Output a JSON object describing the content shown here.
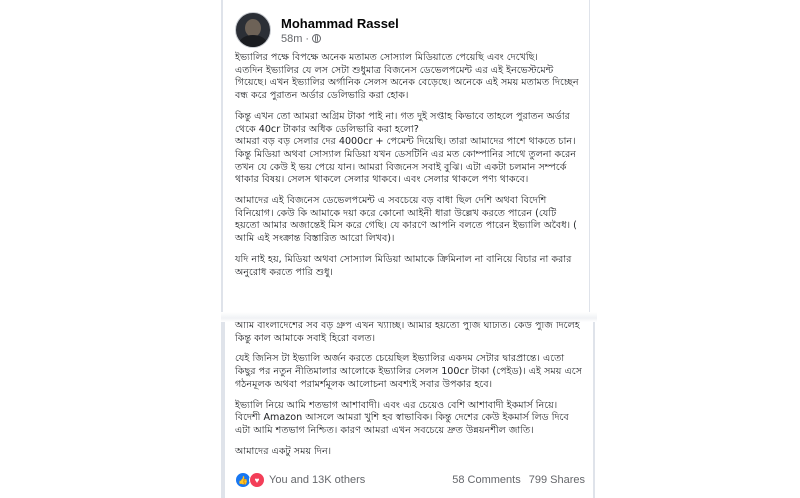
{
  "post": {
    "author": "Mohammad Rassel",
    "time": "58m",
    "paragraphs_top": [
      "ইভ্যালির পক্ষে বিপক্ষে অনেক মতামত সোস্যাল মিডিয়াতে পেয়েছি এবং দেখেছি।\nএতদিন ইভ্যালির যে লস সেটা শুধুমাত্র বিজনেস ডেভেলপমেন্ট এর এই ইনভেস্টমেন্ট গিয়েছে। এখন ইভ্যালির অর্গানিক সেলস অনেক বেড়েছে। অনেকে এই সময় মতামত দিচ্ছেন বন্ধ করে পুরাতন অর্ডার ডেলিভারি করা হোক।",
      "কিন্তু এখন তো আমরা অগ্রিম টাকা পাই না। গত দুই সপ্তাহ কিভাবে তাহলে পুরাতন অর্ডার থেকে 40cr টাকার অধিক ডেলিভারি করা হলো?\nআমরা বড় বড় সেলার দের 4000cr + পেমেন্ট দিয়েছি। তারা আমাদের পাশে থাকতে চান। কিন্তু মিডিয়া অথবা সোস্যাল মিডিয়া যখন ডেসটিনি এর মত কোম্পানির সাথে তুলনা করেন তখন যে কেউ ই ভয় পেয়ে যান। আমরা বিজনেস সবাই বুঝি। এটা একটা চলমান সম্পর্কে থাকার বিষয়। সেলস থাকলে সেলার থাকবে। এবং সেলার থাকলে পণ্য থাকবে।",
      "আমাদের এই বিজনেস ডেভেলপমেন্ট এ সবচেয়ে বড় বাধা ছিল দেশি অথবা বিদেশি বিনিয়োগ। কেউ কি আমাকে দয়া করে কোনো আইনী ধারা উল্লেখ করতে পারেন (যেটি হয়তো আমার অজান্তেই মিস করে গেছি। যে কারণে আপনি বলতে পারেন ইভ্যালি অবৈধ। ( আমি এই সংক্রান্ত বিস্তারিত আরো লিখব)।",
      "যদি নাই হয়, মিডিয়া অথবা সোস্যাল মিডিয়া আমাকে ক্রিমিনাল না বানিয়ে বিচার না করার অনুরোধ করতে পারি শুধু।"
    ],
    "paragraphs_bottom": [
      "আমি বাংলাদেশের সব বড় গ্রুপ এখন খ্যাচ্ছি। আমার হয়তো পুঁজি ঘাটতি। কেউ পুঁজি দিলেই কিন্তু কাল আমাকে সবাই হিরো বলত।",
      "যেই জিনিস টা ইভ্যালি অর্জন করতে চেয়েছিল ইভ্যালির একদম সেটার দ্বারপ্রান্তে। এতো কিছুর পর নতুন নীতিমালার আলোকে ইভ্যালির সেলস 100cr টাকা (পেইড)। এই সময় এসে গঠনমূলক অথবা পরামর্শমূলক আলোচনা অবশ্যই সবার উপকার হবে।",
      "ইভ্যালি নিয়ে আমি শতভাগ আশাবাদী। এবং এর চেয়েও বেশি আশাবাদী ইকমার্স নিয়ে। বিদেশী Amazon আসলে আমরা খুশি হব স্বাভাবিক। কিন্তু দেশের কেউ ইকমার্স লিড দিবে এটা আমি শতভাগ নিশ্চিত। কারণ আমরা এখন সবচেয়ে দ্রুত উন্নয়নশীল জাতি।",
      "আমাদের একটু সময় দিন।"
    ],
    "reactions_text": "You and 13K others",
    "comments": "58 Comments",
    "shares": "799 Shares"
  },
  "icons": {
    "reactions": [
      "like-icon",
      "love-icon"
    ],
    "privacy": "globe-icon"
  },
  "colors": {
    "like": "#1877f2",
    "love": "#f33e58",
    "secondary_text": "#65676b"
  }
}
